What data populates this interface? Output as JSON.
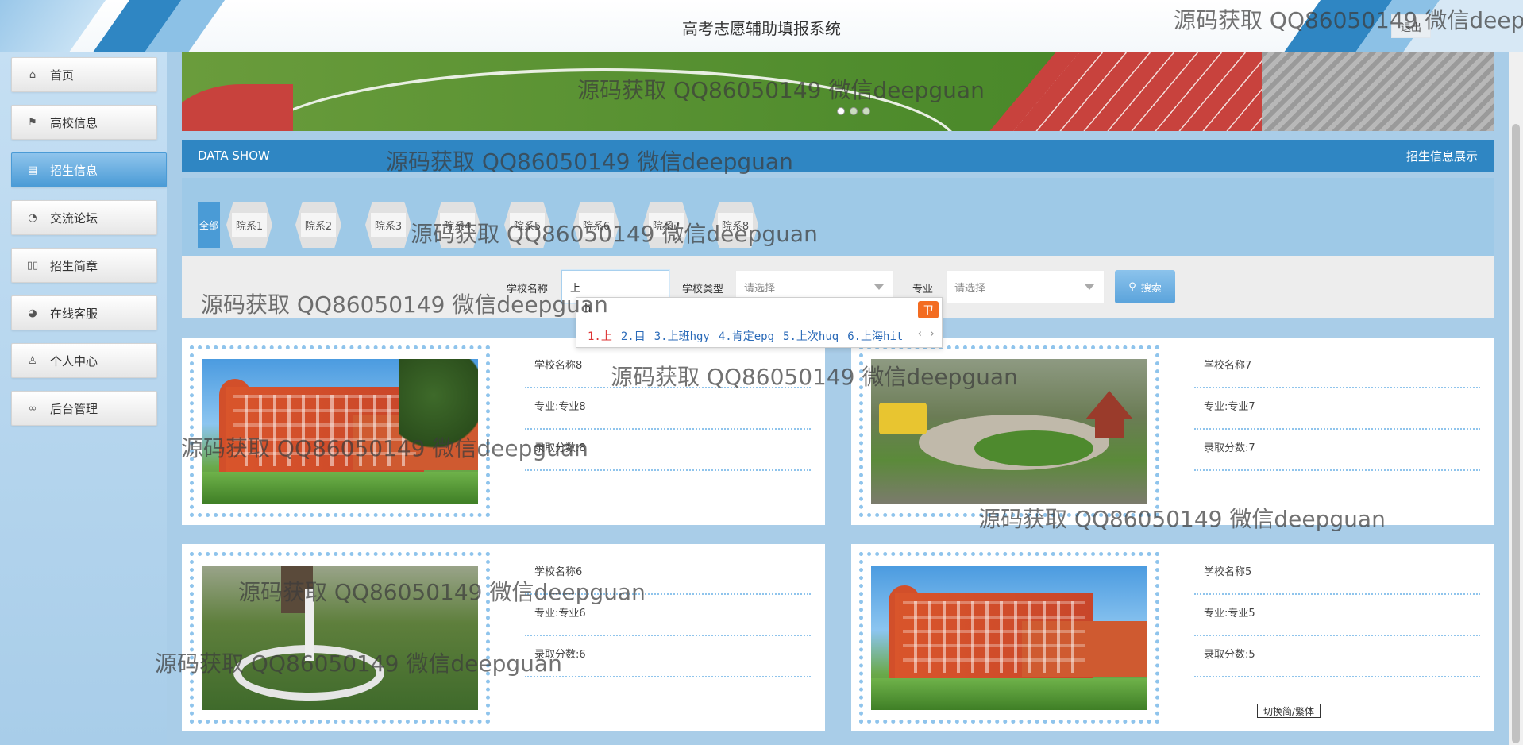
{
  "header": {
    "title": "高考志愿辅助填报系统",
    "logout_label": "退出"
  },
  "sidebar": {
    "items": [
      {
        "label": "首页",
        "icon": "home-icon",
        "glyph": "⌂"
      },
      {
        "label": "高校信息",
        "icon": "flag-icon",
        "glyph": "⚑"
      },
      {
        "label": "招生信息",
        "icon": "list-icon",
        "glyph": "▤",
        "active": true
      },
      {
        "label": "交流论坛",
        "icon": "palette-icon",
        "glyph": "◔"
      },
      {
        "label": "招生简章",
        "icon": "book-icon",
        "glyph": "▯▯"
      },
      {
        "label": "在线客服",
        "icon": "headset-icon",
        "glyph": "◕"
      },
      {
        "label": "个人中心",
        "icon": "user-icon",
        "glyph": "♙"
      },
      {
        "label": "后台管理",
        "icon": "link-icon",
        "glyph": "∞"
      }
    ]
  },
  "section": {
    "left_title": "DATA SHOW",
    "right_title": "招生信息展示"
  },
  "tabs": {
    "all_label": "全部",
    "items": [
      "院系1",
      "院系2",
      "院系3",
      "院系4",
      "院系5",
      "院系6",
      "院系7",
      "院系8"
    ]
  },
  "search": {
    "school_name_label": "学校名称",
    "school_name_value": "上",
    "school_type_label": "学校类型",
    "school_type_placeholder": "请选择",
    "major_label": "专业",
    "major_placeholder": "请选择",
    "button_label": "搜索"
  },
  "ime": {
    "composition": "h",
    "candidates": [
      "1.上",
      "2.目",
      "3.上班hgy",
      "4.肯定epg",
      "5.上次huq",
      "6.上海hit"
    ],
    "nav": "‹ ›"
  },
  "cards": [
    {
      "name_label": "学校名称8",
      "major_label": "专业:专业8",
      "score_label": "录取分数:8"
    },
    {
      "name_label": "学校名称7",
      "major_label": "专业:专业7",
      "score_label": "录取分数:7"
    },
    {
      "name_label": "学校名称6",
      "major_label": "专业:专业6",
      "score_label": "录取分数:6"
    },
    {
      "name_label": "学校名称5",
      "major_label": "专业:专业5",
      "score_label": "录取分数:5"
    }
  ],
  "watermark": "源码获取 QQ86050149 微信deepguan",
  "footer": {
    "toggle_label": "切换简/繁体"
  },
  "colors": {
    "primary": "#2f86c3",
    "accent": "#8fc4ec",
    "background": "#a9cde8"
  }
}
